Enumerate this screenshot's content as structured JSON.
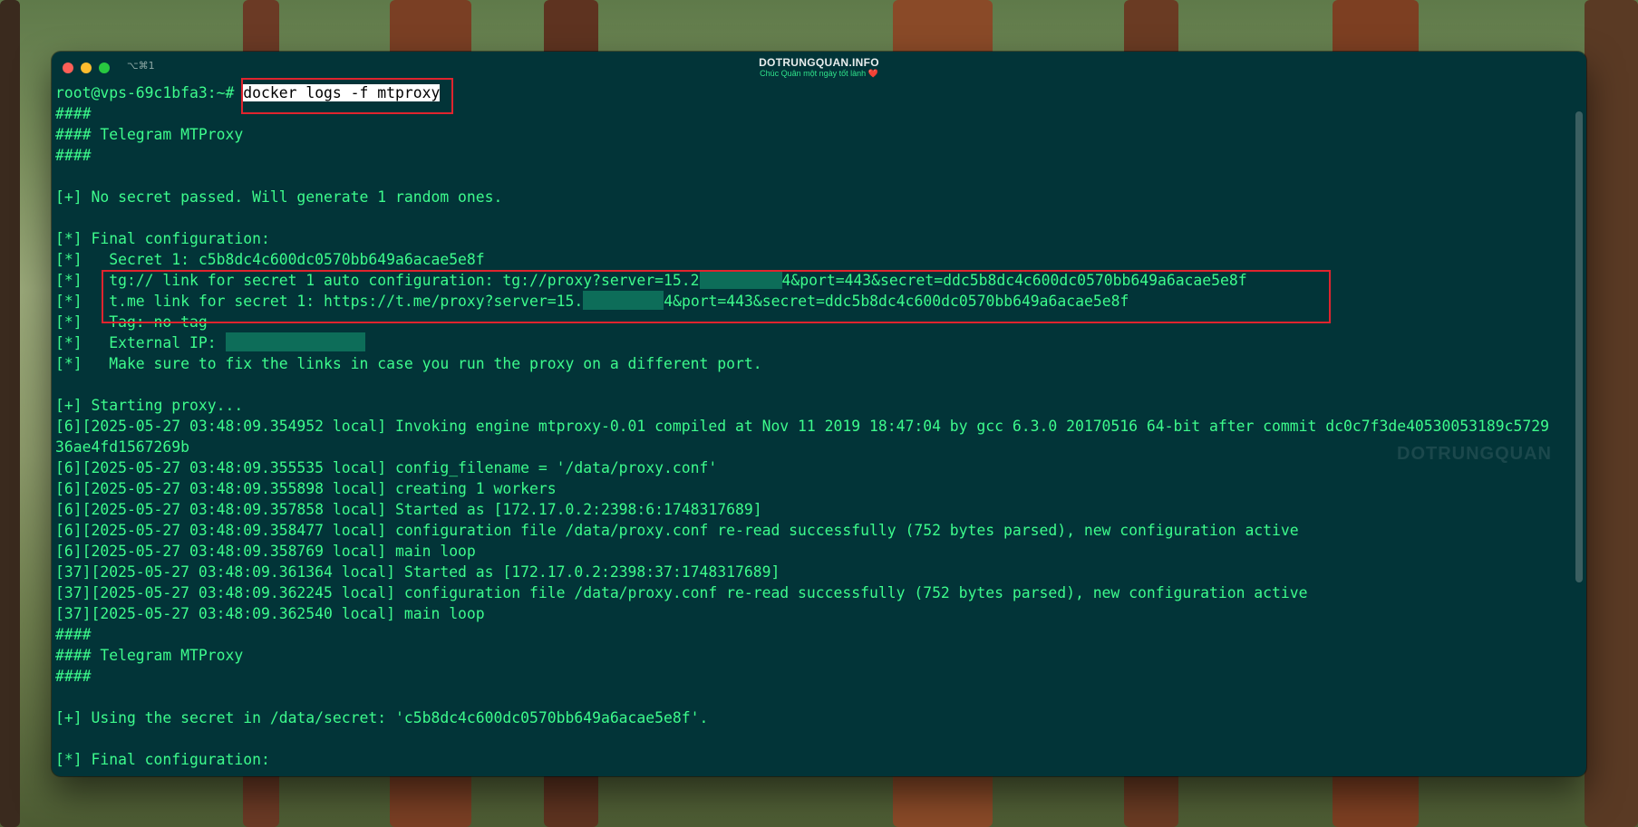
{
  "window": {
    "shortcut": "⌥⌘1",
    "title": "DOTRUNGQUAN.INFO",
    "subtitle": "Chúc Quân một ngày tốt lành ❤️"
  },
  "terminal": {
    "prompt": "root@vps-69c1bfa3:~#",
    "command": "docker logs -f mtproxy",
    "lines": [
      "####",
      "#### Telegram MTProxy",
      "####",
      "",
      "[+] No secret passed. Will generate 1 random ones.",
      "",
      "[*] Final configuration:",
      "[*]   Secret 1: c5b8dc4c600dc0570bb649a6acae5e8f",
      "[*]   tg:// link for secret 1 auto configuration: tg://proxy?server=15.2",
      "4&port=443&secret=ddc5b8dc4c600dc0570bb649a6acae5e8f",
      "[*]   t.me link for secret 1: https://t.me/proxy?server=15.",
      "4&port=443&secret=ddc5b8dc4c600dc0570bb649a6acae5e8f",
      "[*]   Tag: no tag",
      "[*]   External IP: ",
      "[*]   Make sure to fix the links in case you run the proxy on a different port.",
      "",
      "[+] Starting proxy...",
      "[6][2025-05-27 03:48:09.354952 local] Invoking engine mtproxy-0.01 compiled at Nov 11 2019 18:47:04 by gcc 6.3.0 20170516 64-bit after commit dc0c7f3de40530053189c5729",
      "36ae4fd1567269b",
      "[6][2025-05-27 03:48:09.355535 local] config_filename = '/data/proxy.conf'",
      "[6][2025-05-27 03:48:09.355898 local] creating 1 workers",
      "[6][2025-05-27 03:48:09.357858 local] Started as [172.17.0.2:2398:6:1748317689]",
      "[6][2025-05-27 03:48:09.358477 local] configuration file /data/proxy.conf re-read successfully (752 bytes parsed), new configuration active",
      "[6][2025-05-27 03:48:09.358769 local] main loop",
      "[37][2025-05-27 03:48:09.361364 local] Started as [172.17.0.2:2398:37:1748317689]",
      "[37][2025-05-27 03:48:09.362245 local] configuration file /data/proxy.conf re-read successfully (752 bytes parsed), new configuration active",
      "[37][2025-05-27 03:48:09.362540 local] main loop",
      "####",
      "#### Telegram MTProxy",
      "####",
      "",
      "[+] Using the secret in /data/secret: 'c5b8dc4c600dc0570bb649a6acae5e8f'.",
      "",
      "[*] Final configuration:"
    ]
  },
  "watermark": "DOTRUNGQUAN",
  "colors": {
    "terminal_bg": "#023438",
    "terminal_text": "#3dfb8c",
    "highlight_border": "#e0242e",
    "redaction": "#0d6d59"
  }
}
